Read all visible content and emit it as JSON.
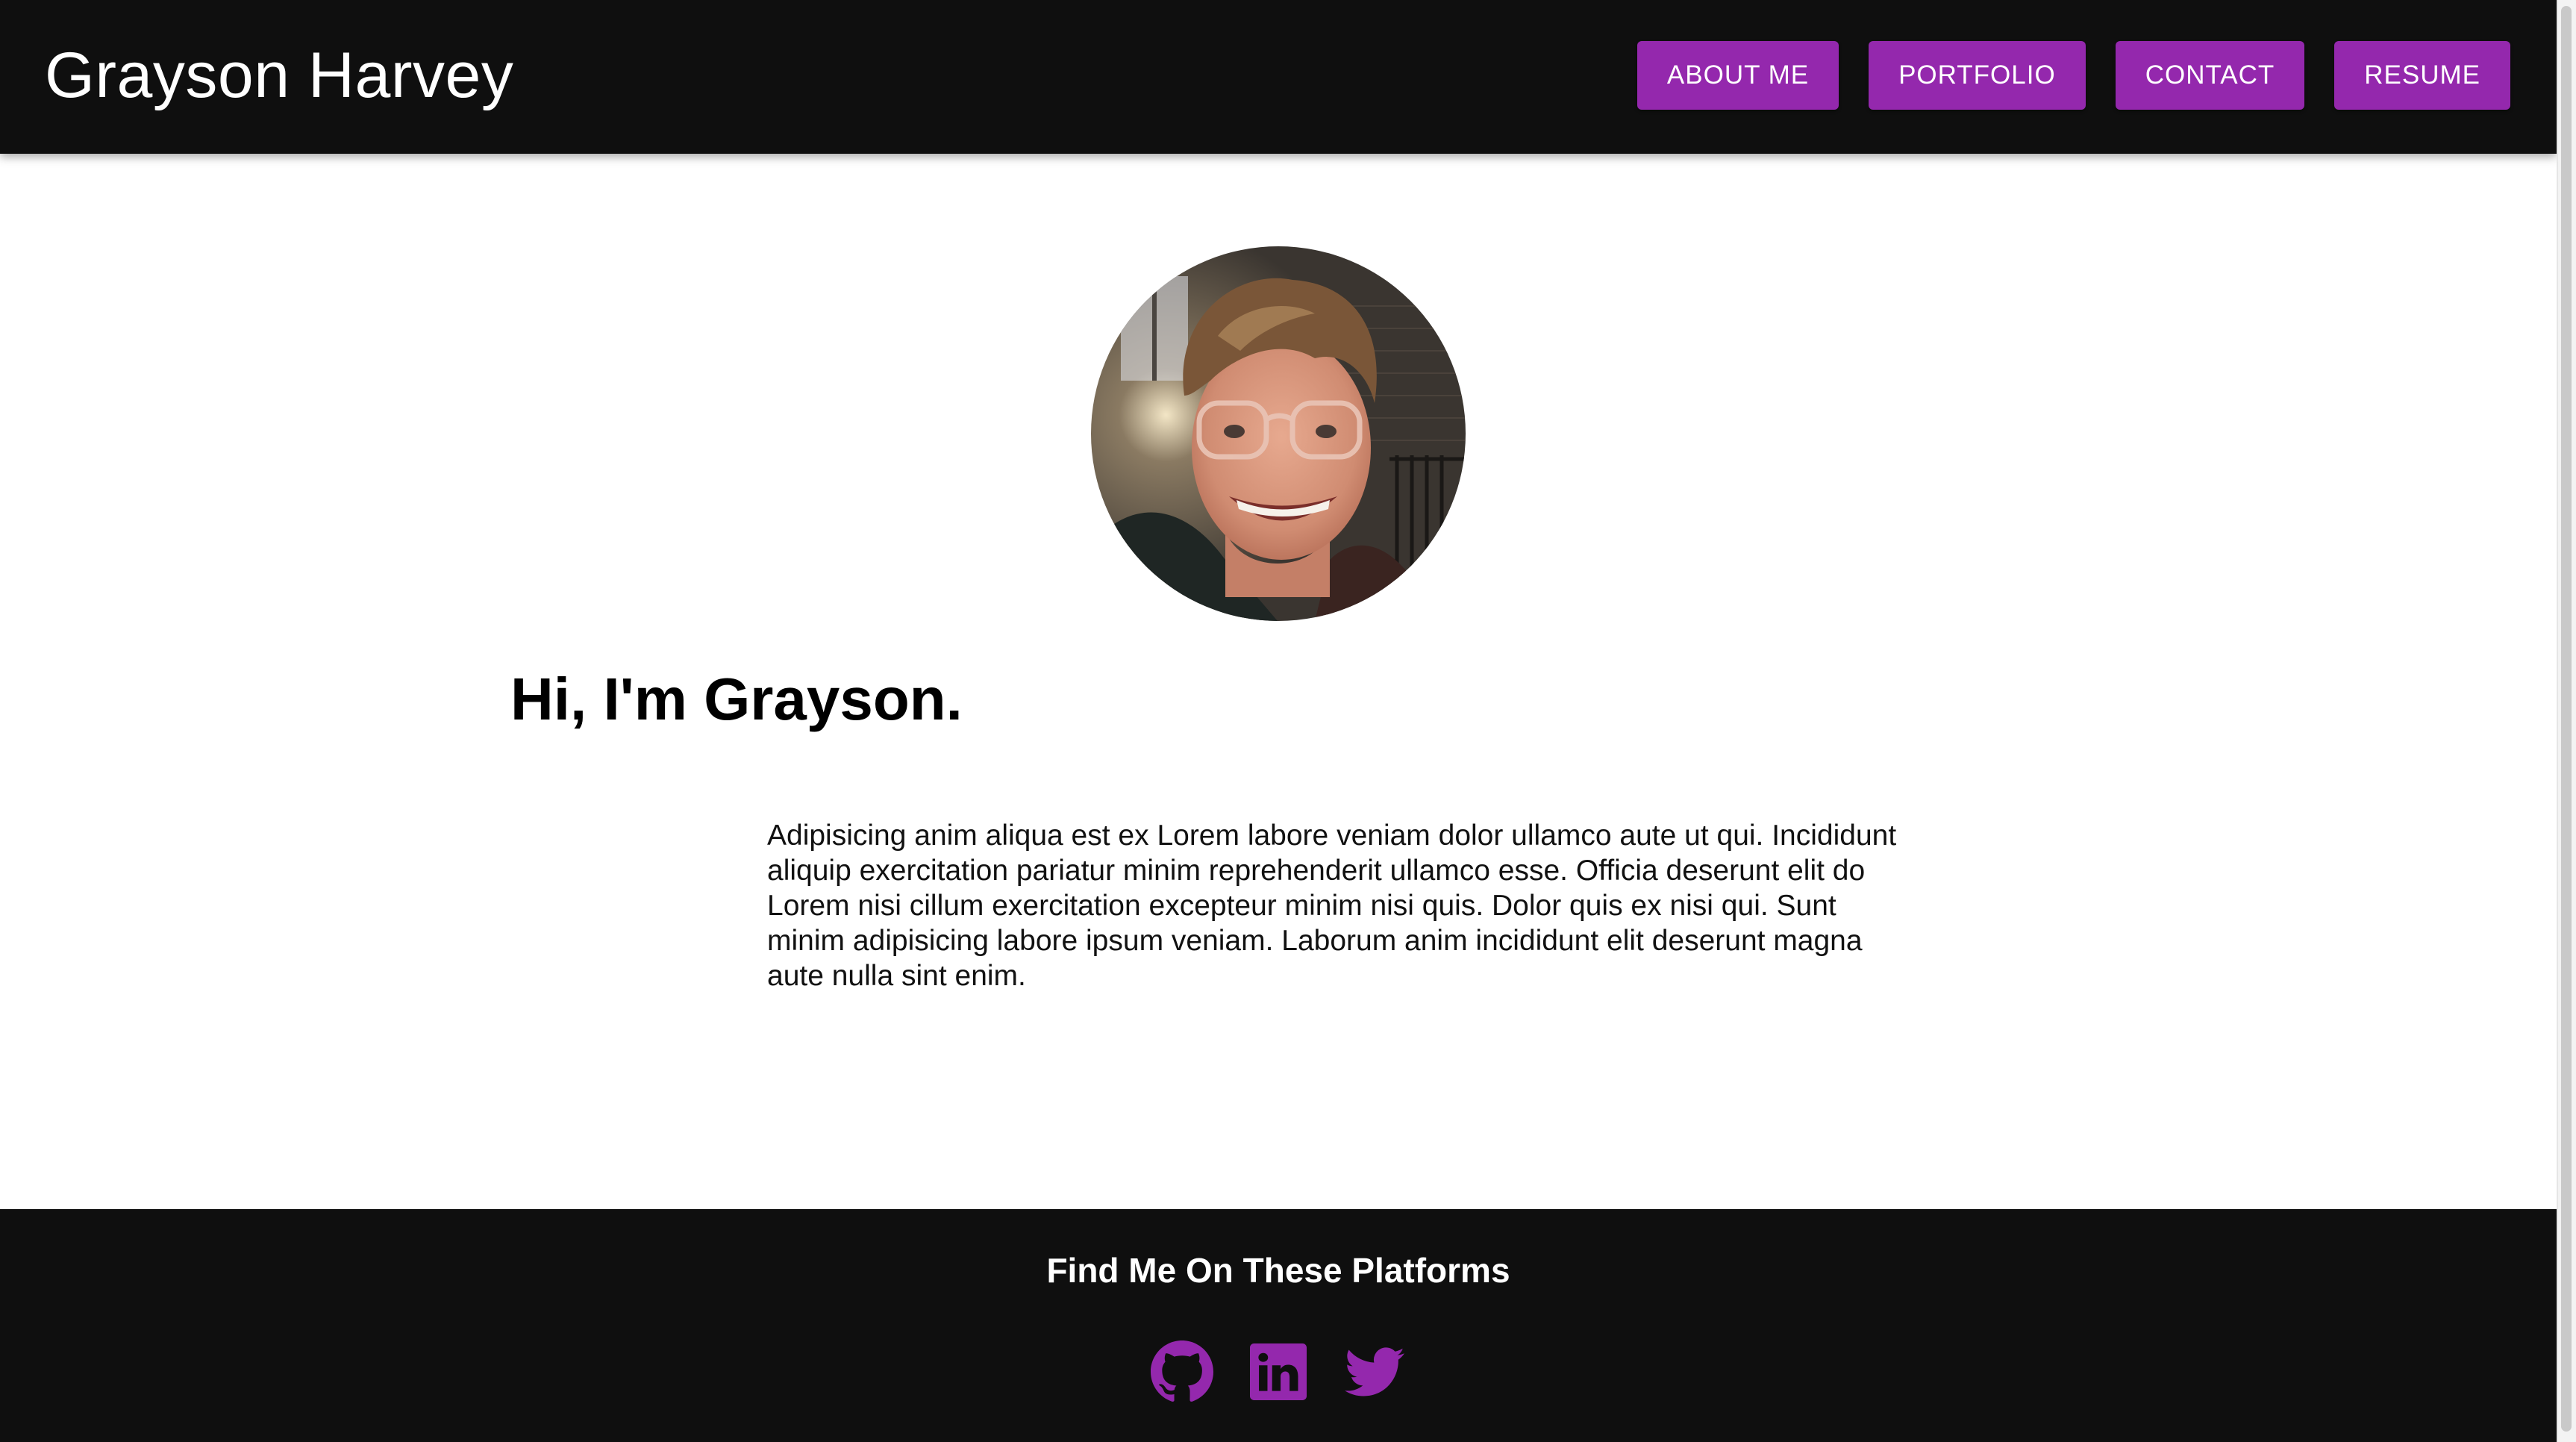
{
  "header": {
    "brand": "Grayson Harvey",
    "nav": [
      {
        "label": "ABOUT ME"
      },
      {
        "label": "PORTFOLIO"
      },
      {
        "label": "CONTACT"
      },
      {
        "label": "RESUME"
      }
    ]
  },
  "main": {
    "avatar_icon": "profile-photo",
    "heading": "Hi, I'm Grayson.",
    "bio": "Adipisicing anim aliqua est ex Lorem labore veniam dolor ullamco aute ut qui. Incididunt aliquip exercitation pariatur minim reprehenderit ullamco esse. Officia deserunt elit do Lorem nisi cillum exercitation excepteur minim nisi quis. Dolor quis ex nisi qui. Sunt minim adipisicing labore ipsum veniam. Laborum anim incididunt elit deserunt magna aute nulla sint enim."
  },
  "footer": {
    "title": "Find Me On These Platforms",
    "icons": [
      "github-icon",
      "linkedin-icon",
      "twitter-icon"
    ]
  },
  "colors": {
    "accent": "#9428ad",
    "header_bg": "#0f0f0f",
    "footer_bg": "#0f0f0f",
    "page_bg": "#ffffff"
  }
}
